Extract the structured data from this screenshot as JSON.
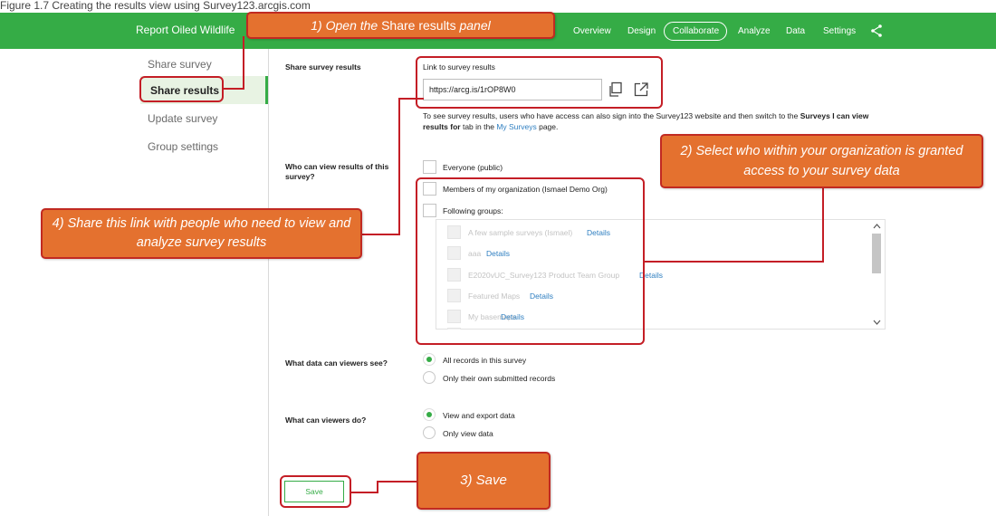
{
  "caption": "Figure 1.7 Creating the results view using Survey123.arcgis.com",
  "header": {
    "brand": "Report Oiled Wildlife",
    "nav": [
      "Overview",
      "Design",
      "Collaborate",
      "Analyze",
      "Data",
      "Settings"
    ],
    "active_tab": "Collaborate"
  },
  "sidebar": {
    "items": [
      "Share survey",
      "Share results",
      "Update survey",
      "Group settings"
    ],
    "active": "Share results"
  },
  "share_results": {
    "section_label": "Share survey results",
    "link_label": "Link to survey results",
    "link_value": "https://arcg.is/1rOP8W0",
    "help_pre": "To see survey results, users who have access can also sign into the Survey123 website and then switch to the",
    "help_bold": "Surveys I can view results for",
    "help_mid": "tab in the",
    "help_link": "My Surveys",
    "help_post": "page."
  },
  "who_can_view": {
    "label": "Who can view results of this survey?",
    "options": [
      "Everyone (public)",
      "Members of my organization (Ismael Demo Org)",
      "Following groups:"
    ],
    "groups": [
      {
        "name": "A few sample surveys (Ismael)",
        "link": "Details"
      },
      {
        "name": "aaa",
        "link": "Details"
      },
      {
        "name": "E2020vUC_Survey123 Product Team Group",
        "link": "Details"
      },
      {
        "name": "Featured Maps",
        "link": "Details"
      },
      {
        "name": "My basemaps",
        "link": "Details"
      }
    ]
  },
  "data_viewers_see": {
    "label": "What data can viewers see?",
    "options": [
      "All records in this survey",
      "Only their own submitted records"
    ],
    "selected": "All records in this survey"
  },
  "viewers_do": {
    "label": "What can viewers do?",
    "options": [
      "View and export data",
      "Only view data"
    ],
    "selected": "View and export data"
  },
  "save_label": "Save",
  "callouts": {
    "c1_pre": "1) Open the ",
    "c1_mid": "Share results",
    "c1_post": " panel",
    "c2": "2) Select who within your organization is granted access to your survey data",
    "c3": "3) Save",
    "c4": "4) Share this link with people who need to view and analyze survey results"
  },
  "colors": {
    "brand_green": "#35ac46",
    "callout_orange": "#e4712f",
    "callout_border": "#c41e26",
    "link_blue": "#2f7fc1"
  }
}
